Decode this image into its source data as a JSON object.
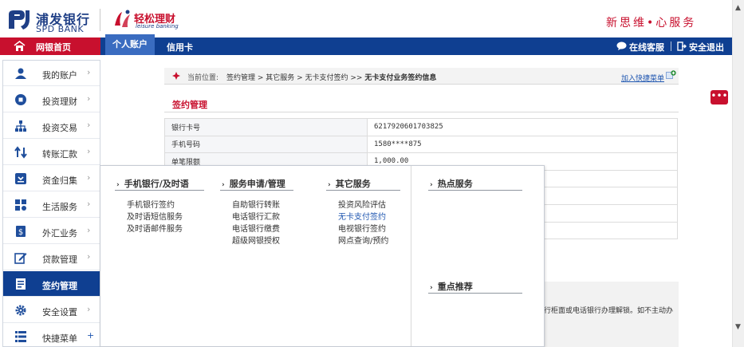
{
  "header": {
    "bank_name_cn": "浦发银行",
    "bank_name_en": "SPD BANK",
    "leisure_name_cn": "轻松理财",
    "leisure_name_en": "leisure banking",
    "slogan": "新思维•心服务"
  },
  "nav": {
    "home": "网银首页",
    "tab_personal": "个人账户",
    "tab_credit": "信用卡",
    "online_service": "在线客服",
    "logout": "安全退出"
  },
  "sidebar": {
    "items": [
      {
        "label": "我的账户",
        "icon": "user-icon"
      },
      {
        "label": "投资理财",
        "icon": "record-icon"
      },
      {
        "label": "投资交易",
        "icon": "network-icon"
      },
      {
        "label": "转账汇款",
        "icon": "transfer-arrows-icon"
      },
      {
        "label": "资金归集",
        "icon": "collection-box-icon"
      },
      {
        "label": "生活服务",
        "icon": "life-service-icon"
      },
      {
        "label": "外汇业务",
        "icon": "forex-icon"
      },
      {
        "label": "贷款管理",
        "icon": "edit-icon"
      },
      {
        "label": "签约管理",
        "icon": "contract-icon"
      },
      {
        "label": "安全设置",
        "icon": "gear-icon"
      },
      {
        "label": "快捷菜单",
        "icon": "list-icon"
      }
    ],
    "arrow": "›",
    "plus": "+"
  },
  "breadcrumb": {
    "label": "当前位置:",
    "path": "签约管理 > 其它服务 > 无卡支付签约 >> ",
    "current": "无卡支付业务签约信息",
    "shortcut": "加入快捷菜单"
  },
  "section": {
    "title": "签约管理"
  },
  "table": {
    "rows": [
      {
        "label": "银行卡号",
        "value": "6217920601703825"
      },
      {
        "label": "手机号码",
        "value": "1580****875"
      },
      {
        "label": "单笔限额",
        "value": "1,000.00"
      },
      {
        "label": "",
        "value": ""
      },
      {
        "label": "",
        "value": ""
      },
      {
        "label": "",
        "value": ""
      },
      {
        "label": "",
        "value": ""
      }
    ]
  },
  "note": "行柜面或电话银行办理解锁。如不主动办",
  "mega_menu": {
    "chevron": "›",
    "columns": [
      {
        "title": "手机银行/及时语",
        "links": [
          "手机银行签约",
          "及时语短信服务",
          "及时语邮件服务"
        ]
      },
      {
        "title": "服务申请/管理",
        "links": [
          "自助银行转账",
          "电话银行汇款",
          "电话银行缴费",
          "超级网银授权"
        ]
      },
      {
        "title": "其它服务",
        "links": [
          "投资风险评估",
          "无卡支付签约",
          "电视银行签约",
          "网点查询/预约"
        ]
      }
    ],
    "highlight": "无卡支付签约",
    "hot_title": "热点服务",
    "rec_title": "重点推荐"
  },
  "float_widget": {
    "text": "•••"
  },
  "scrollbar": {
    "up": "▲",
    "down": "▼"
  },
  "colors": {
    "brand_red": "#c8102e",
    "nav_blue": "#0f3f91",
    "tab_blue": "#3a6cc0",
    "link_blue": "#1f56b0"
  }
}
